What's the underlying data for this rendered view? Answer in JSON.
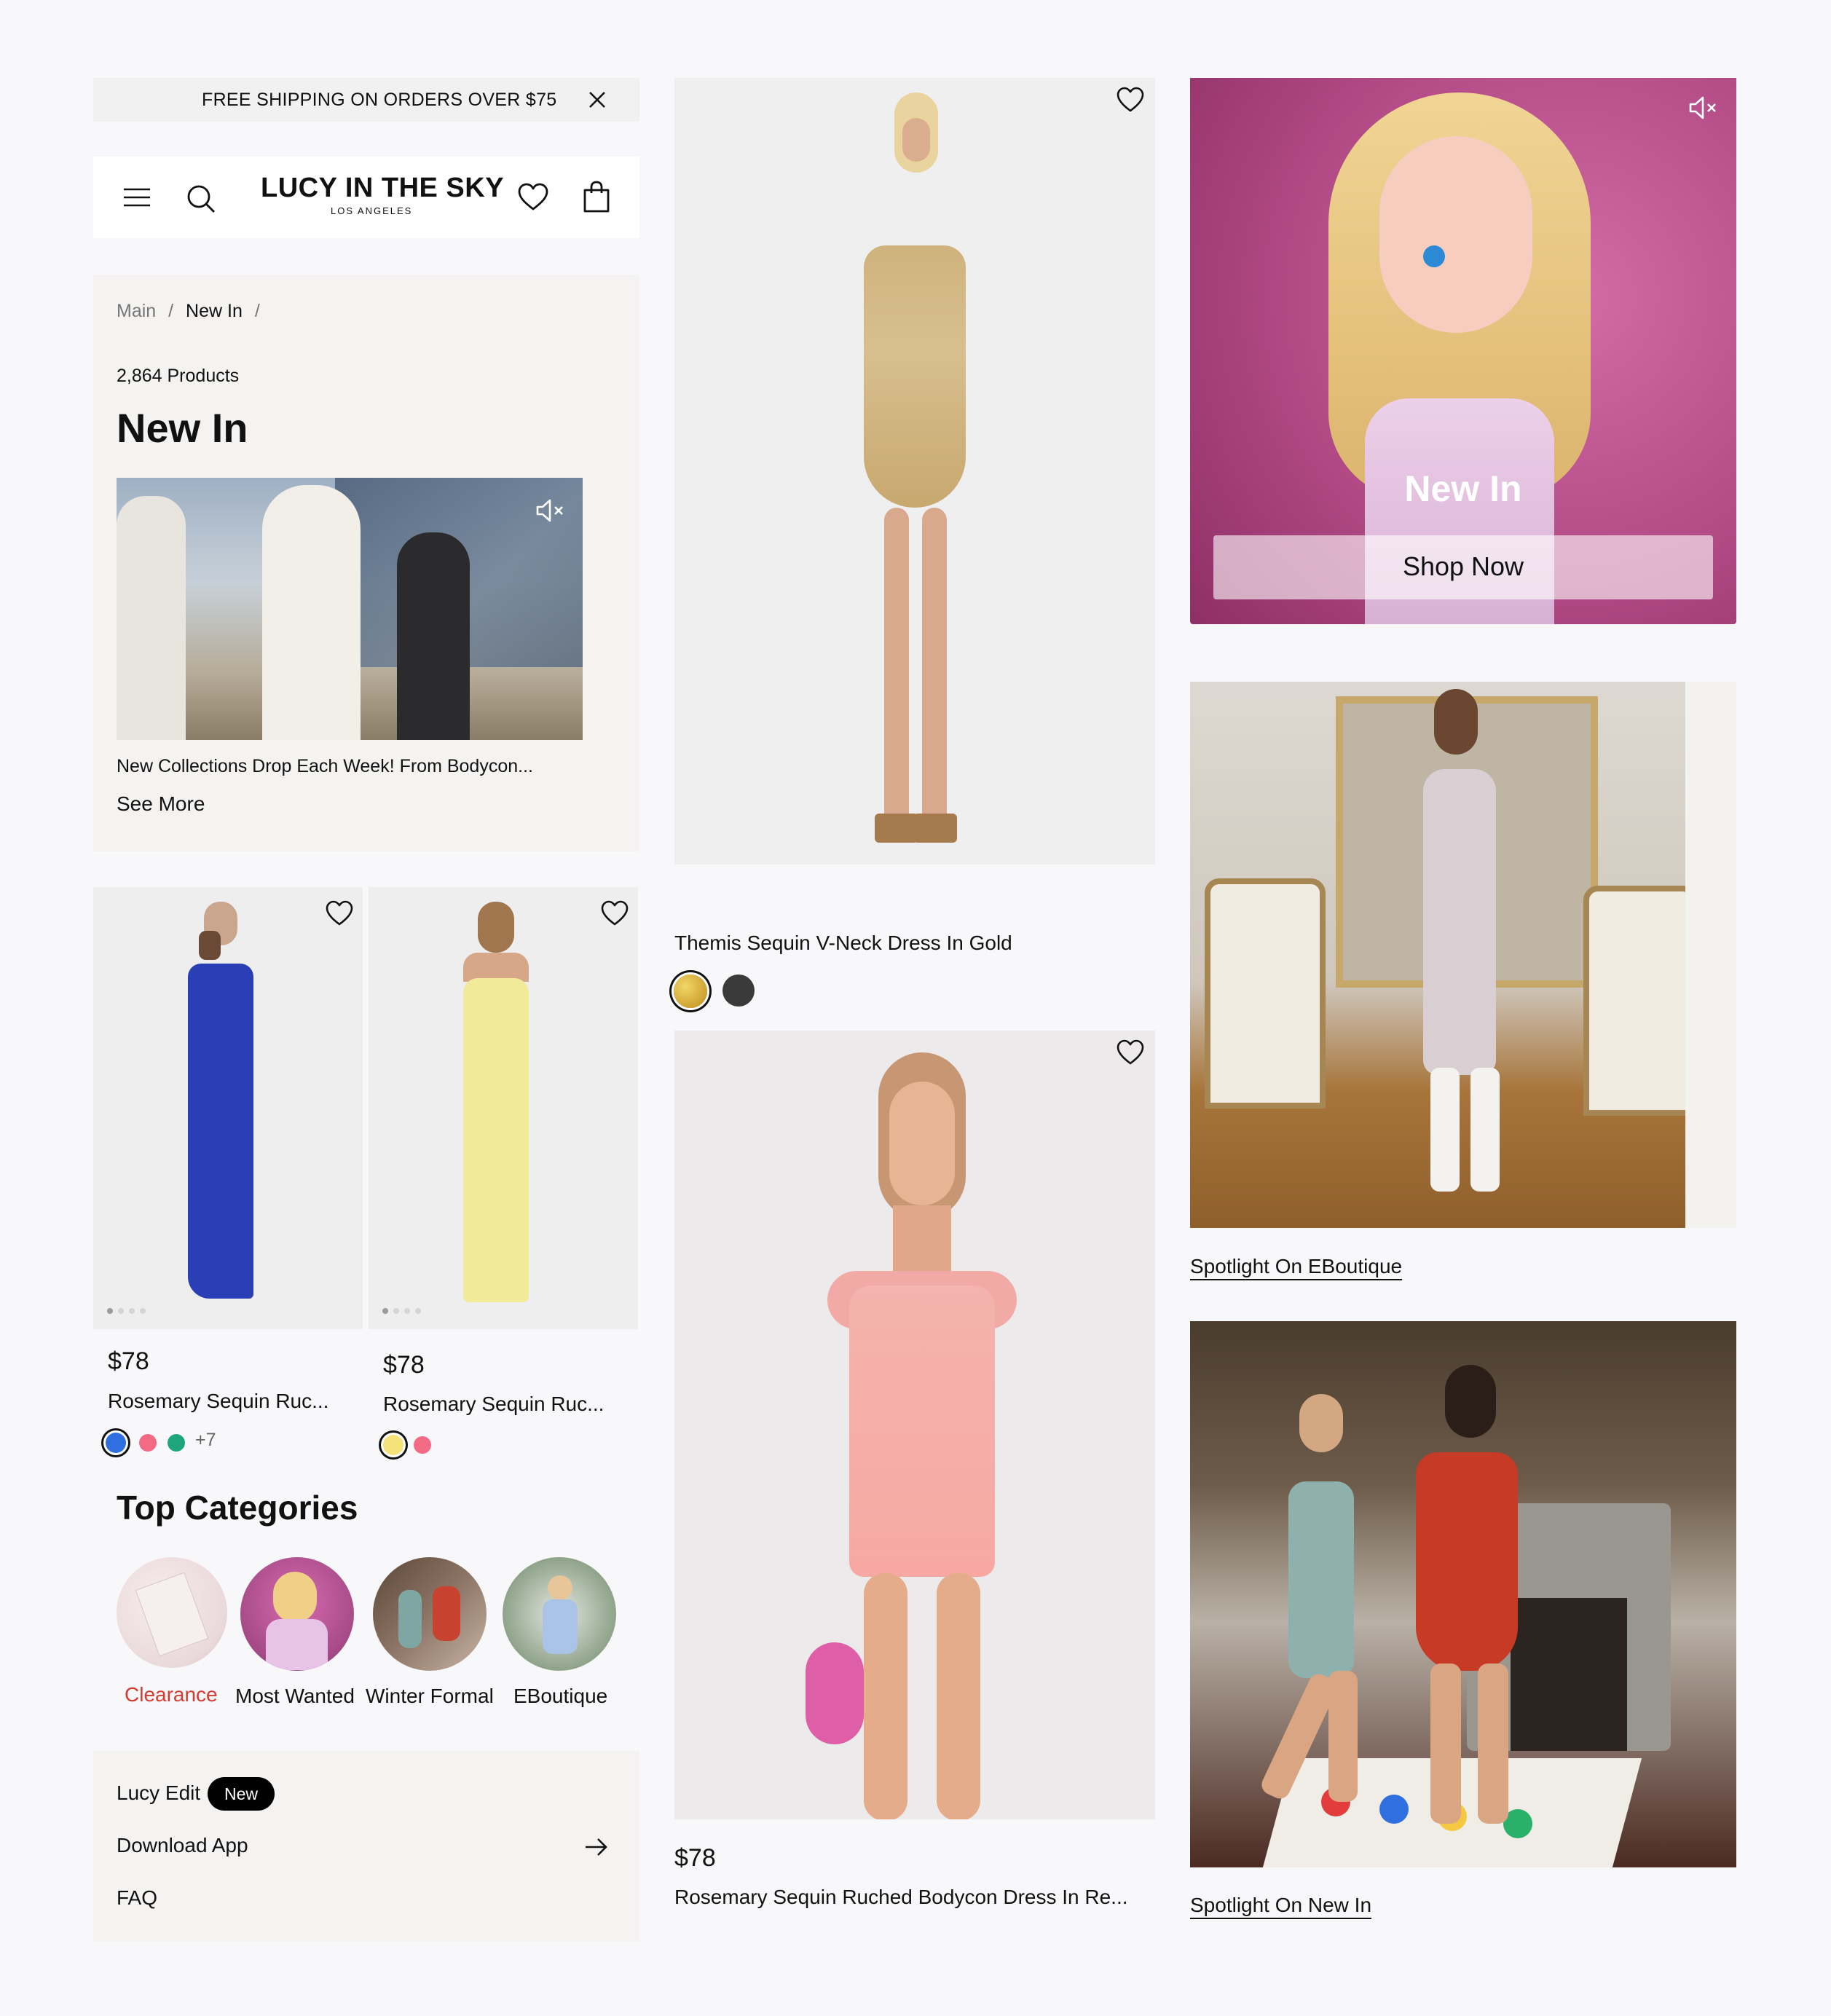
{
  "promo_bar": {
    "text": "FREE SHIPPING ON ORDERS OVER $75"
  },
  "header": {
    "logo_title": "LUCY IN THE SKY",
    "logo_subtitle": "LOS ANGELES"
  },
  "breadcrumb": {
    "items": [
      "Main",
      "New In"
    ]
  },
  "listing": {
    "count": "2,864 Products",
    "title": "New In",
    "description": "New Collections Drop Each Week! From Bodycon...",
    "see_more": "See More"
  },
  "products_small": [
    {
      "price": "$78",
      "name": "Rosemary Sequin Ruc...",
      "swatches": [
        "#2f6fe0",
        "#f26a83",
        "#1fa57a"
      ],
      "more": "+7"
    },
    {
      "price": "$78",
      "name": "Rosemary Sequin Ruc...",
      "swatches": [
        "#f5e27a",
        "#f26a83"
      ]
    }
  ],
  "top_categories": {
    "title": "Top Categories",
    "items": [
      {
        "label": "Clearance",
        "accent": "#d63a2f"
      },
      {
        "label": "Most Wanted"
      },
      {
        "label": "Winter Formal"
      },
      {
        "label": "EBoutique"
      }
    ]
  },
  "footer_menu": {
    "lucy_edit": "Lucy Edit",
    "badge": "New",
    "download_app": "Download App",
    "faq": "FAQ"
  },
  "featured_product": {
    "name": "Themis Sequin V-Neck Dress In Gold",
    "swatches": [
      "#d4ad3a",
      "#3a3a3a"
    ]
  },
  "pink_product": {
    "price": "$78",
    "name": "Rosemary Sequin Ruched Bodycon Dress In Re..."
  },
  "hero_banner": {
    "title": "New In",
    "button": "Shop Now"
  },
  "spotlights": [
    {
      "label": "Spotlight On EBoutique"
    },
    {
      "label": "Spotlight On New In"
    }
  ]
}
